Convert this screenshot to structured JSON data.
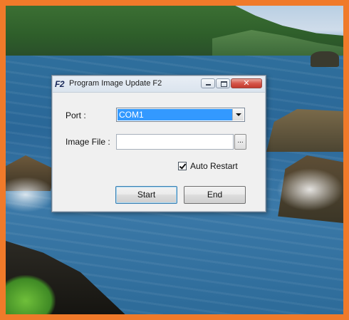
{
  "window": {
    "icon_text": "F2",
    "title": "Program Image Update F2",
    "close_glyph": "✕"
  },
  "form": {
    "port_label": "Port :",
    "port_value": "COM1",
    "image_label": "Image File :",
    "image_value": "",
    "browse_label": "...",
    "auto_restart_label": "Auto Restart",
    "auto_restart_checked": true
  },
  "buttons": {
    "start": "Start",
    "end": "End"
  },
  "colors": {
    "frame": "#f07a2a",
    "selection": "#3399ff"
  }
}
